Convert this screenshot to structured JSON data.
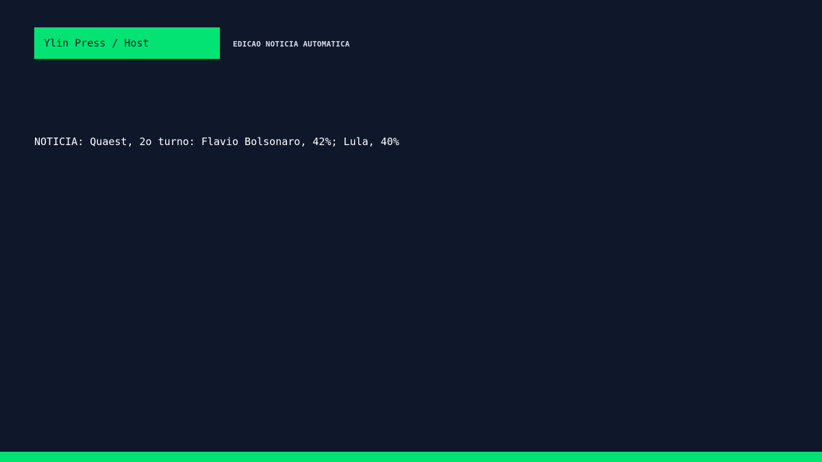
{
  "header": {
    "brand": "Ylin Press / Host",
    "edition_label": "EDICAO NOTICIA AUTOMATICA"
  },
  "main": {
    "headline": "NOTICIA: Quaest, 2o turno: Flavio Bolsonaro, 42%; Lula, 40%"
  },
  "colors": {
    "background": "#0f182b",
    "accent": "#03e373",
    "text": "#ffffff",
    "muted_text": "#d6dbea"
  }
}
